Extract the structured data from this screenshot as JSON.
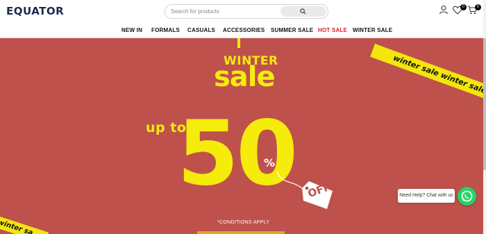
{
  "header": {
    "logo": "EQUATOR",
    "search": {
      "placeholder": "Search for products"
    },
    "wishlist_count": "0",
    "cart_count": "0"
  },
  "nav": {
    "items": [
      {
        "label": "NEW IN"
      },
      {
        "label": "FORMALS"
      },
      {
        "label": "CASUALS"
      },
      {
        "label": "ACCESSORIES"
      },
      {
        "label": "SUMMER SALE"
      },
      {
        "label": "HOT SALE"
      },
      {
        "label": "WINTER SALE"
      }
    ]
  },
  "banner": {
    "tape_top": "winter sale winter sale winter",
    "tape_bottom": "winter sa",
    "heading_line1": "WINTER",
    "heading_line2": "sale",
    "up_to": "up to",
    "percent_value": "50",
    "percent_sign": "%",
    "tag_text": "OFF",
    "conditions": "*CONDITIONS APPLY"
  },
  "whatsapp": {
    "label": "Need Help? Chat with us"
  },
  "colors": {
    "banner_bg": "#bf514d",
    "accent_yellow": "#f5ec0c",
    "hot_sale": "#e31b23",
    "whatsapp": "#25d366"
  }
}
